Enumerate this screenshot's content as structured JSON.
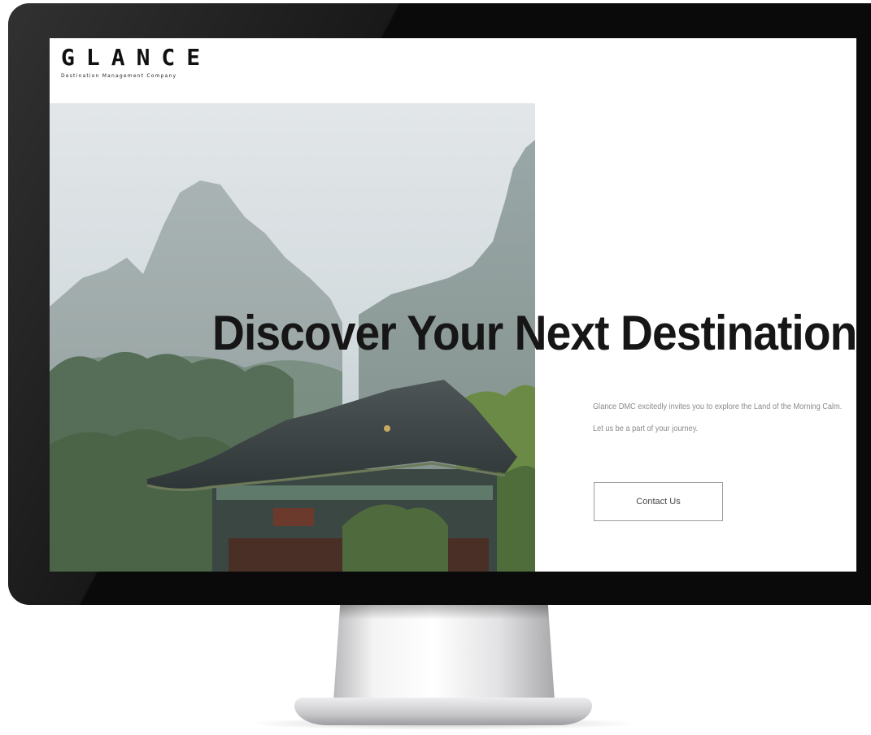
{
  "site": {
    "logo": {
      "name": "GLANCE",
      "tagline": "Destination Management Company"
    },
    "hero": {
      "headline": "Discover Your Next Destination",
      "intro_line_1": "Glance DMC excitedly invites you to explore the Land of the Morning Calm.",
      "intro_line_2": "Let us be a part of your journey.",
      "contact_button": "Contact Us",
      "image_subject": "korean-temple-mountains-photo"
    }
  },
  "colors": {
    "bezel": "#0a0a0a",
    "page_background": "#ffffff",
    "headline": "#161616",
    "body_text": "#8a8a8a",
    "button_border": "#9b9b9b"
  }
}
